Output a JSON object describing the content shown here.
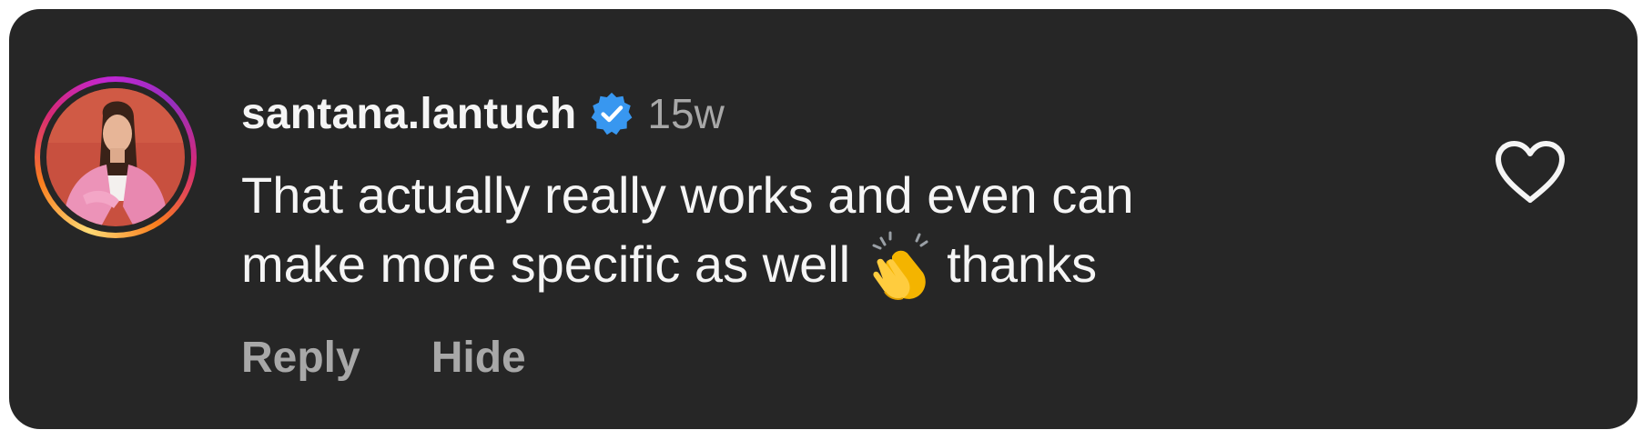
{
  "comment": {
    "author": {
      "username": "santana.lantuch",
      "verified_icon": "verified-badge-icon",
      "avatar_icon": "avatar",
      "story_ring": true
    },
    "timestamp": "15w",
    "text_line1": "That actually really works and even can",
    "text_line2_before": "make more specific as well",
    "emoji": "clapping-hands-icon",
    "text_line2_after": "thanks"
  },
  "actions": {
    "reply_label": "Reply",
    "hide_label": "Hide"
  },
  "like_icon": "heart-outline-icon",
  "colors": {
    "card_background": "#262626",
    "primary_text": "#f5f5f5",
    "secondary_text": "#a8a8a8",
    "verified_blue": "#3897f0"
  }
}
